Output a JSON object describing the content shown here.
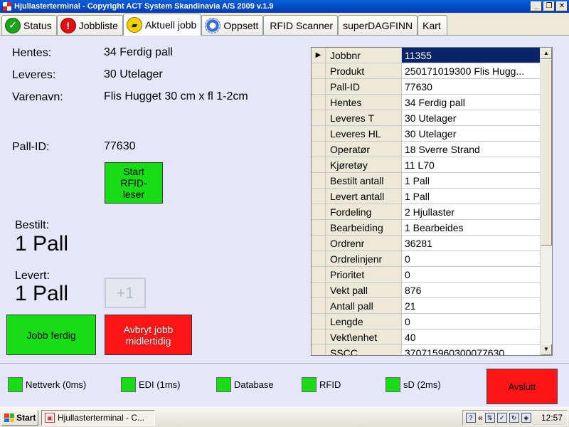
{
  "window": {
    "title": "Hjullasterterminal - Copyright ACT System Skandinavia A/S 2009 v.1.9"
  },
  "tabs": [
    {
      "label": "Status",
      "icon": "green-check-icon"
    },
    {
      "label": "Jobbliste",
      "icon": "red-exclamation-icon"
    },
    {
      "label": "Aktuell jobb",
      "icon": "truck-icon"
    },
    {
      "label": "Oppsett",
      "icon": "gear-icon"
    },
    {
      "label": "RFID Scanner"
    },
    {
      "label": "superDAGFINN"
    },
    {
      "label": "Kart"
    }
  ],
  "job": {
    "hentes_label": "Hentes:",
    "hentes_value": "34 Ferdig pall",
    "leveres_label": "Leveres:",
    "leveres_value": "30 Utelager",
    "varenavn_label": "Varenavn:",
    "varenavn_value": "Flis Hugget 30 cm x fl 1-2cm",
    "pallid_label": "Pall-ID:",
    "pallid_value": "77630",
    "bestilt_label": "Bestilt:",
    "bestilt_value": "1 Pall",
    "levert_label": "Levert:",
    "levert_value": "1 Pall"
  },
  "buttons": {
    "start_rfid": "Start RFID-leser",
    "plus_one": "+1",
    "jobb_ferdig": "Jobb ferdig",
    "avbryt": "Avbryt jobb midlertidig",
    "avslutt": "Avslutt"
  },
  "details": [
    {
      "key": "Jobbnr",
      "value": "11355"
    },
    {
      "key": "Produkt",
      "value": "250171019300 Flis Hugg..."
    },
    {
      "key": "Pall-ID",
      "value": "77630"
    },
    {
      "key": "Hentes",
      "value": "34 Ferdig pall"
    },
    {
      "key": "Leveres T",
      "value": "30 Utelager"
    },
    {
      "key": "Leveres HL",
      "value": "30 Utelager"
    },
    {
      "key": "Operatør",
      "value": "18 Sverre Strand"
    },
    {
      "key": "Kjøretøy",
      "value": "11 L70"
    },
    {
      "key": "Bestilt antall",
      "value": "1 Pall"
    },
    {
      "key": "Levert antall",
      "value": "1 Pall"
    },
    {
      "key": "Fordeling",
      "value": "2 Hjullaster"
    },
    {
      "key": "Bearbeiding",
      "value": "1 Bearbeides"
    },
    {
      "key": "Ordrenr",
      "value": "36281"
    },
    {
      "key": "Ordrelinjenr",
      "value": "0"
    },
    {
      "key": "Prioritet",
      "value": "0"
    },
    {
      "key": "Vekt pall",
      "value": "876"
    },
    {
      "key": "Antall pall",
      "value": "21"
    },
    {
      "key": "Lengde",
      "value": "0"
    },
    {
      "key": "Vekt\\enhet",
      "value": "40"
    },
    {
      "key": "SSCC",
      "value": "370715960300077630"
    }
  ],
  "status": [
    {
      "label": "Nettverk (0ms)"
    },
    {
      "label": "EDI (1ms)"
    },
    {
      "label": "Database"
    },
    {
      "label": "RFID"
    },
    {
      "label": "sD (2ms)"
    }
  ],
  "taskbar": {
    "start_label": "Start",
    "task_label": "Hjullasterterminal - C...",
    "clock": "12:57",
    "tray_chevron": "«"
  },
  "colors": {
    "ok": "#17dd17",
    "danger": "#ff1515",
    "selection": "#0a246a"
  }
}
